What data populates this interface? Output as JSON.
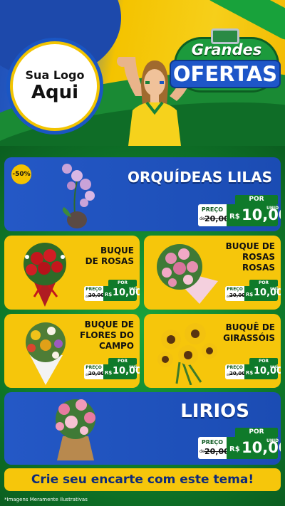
{
  "header": {
    "logo_line1": "Sua Logo",
    "logo_line2": "Aqui",
    "brand_line1": "Grandes",
    "brand_line2": "OFERTAS"
  },
  "products": [
    {
      "name": "ORQUÍDEAS LILAS",
      "badge": "-50%",
      "por": "POR",
      "preco_label": "PREÇO",
      "de": "de",
      "old_price": "20,00",
      "currency": "R$",
      "price": "10,00",
      "unit": "UNID",
      "flower": "orchid-icon"
    },
    {
      "name_lines": [
        "BUQUE",
        "DE ROSAS"
      ],
      "por": "POR",
      "preco_label": "PREÇO",
      "de": "de",
      "old_price": "20,00",
      "currency": "R$",
      "price": "10,00",
      "unit": "UNID",
      "flower": "rose-bouquet-icon"
    },
    {
      "name_lines": [
        "BUQUE DE",
        "ROSAS",
        "ROSAS"
      ],
      "por": "POR",
      "preco_label": "PREÇO",
      "de": "de",
      "old_price": "20,00",
      "currency": "R$",
      "price": "10,00",
      "unit": "UNID",
      "flower": "pink-rose-bouquet-icon"
    },
    {
      "name_lines": [
        "BUQUE DE",
        "FLORES DO",
        "CAMPO"
      ],
      "por": "POR",
      "preco_label": "PREÇO",
      "de": "de",
      "old_price": "20,00",
      "currency": "R$",
      "price": "10,00",
      "unit": "UNID",
      "flower": "wildflower-bouquet-icon"
    },
    {
      "name_lines": [
        "BUQUÊ DE",
        "GIRASSÓIS"
      ],
      "por": "POR",
      "preco_label": "PREÇO",
      "de": "de",
      "old_price": "20,00",
      "currency": "R$",
      "price": "10,00",
      "unit": "UNID",
      "flower": "sunflower-bouquet-icon"
    },
    {
      "name": "LIRIOS",
      "por": "POR",
      "preco_label": "PREÇO",
      "de": "de",
      "old_price": "20,00",
      "currency": "R$",
      "price": "10,00",
      "unit": "UNID",
      "flower": "lily-bouquet-icon"
    }
  ],
  "footer": {
    "cta": "Crie seu encarte com este tema!",
    "disclaimer": "*Imagens Meramente Ilustrativas"
  },
  "colors": {
    "brazil_green": "#0f7a2a",
    "brazil_yellow": "#f6c60b",
    "brazil_blue": "#1f4fb5"
  }
}
